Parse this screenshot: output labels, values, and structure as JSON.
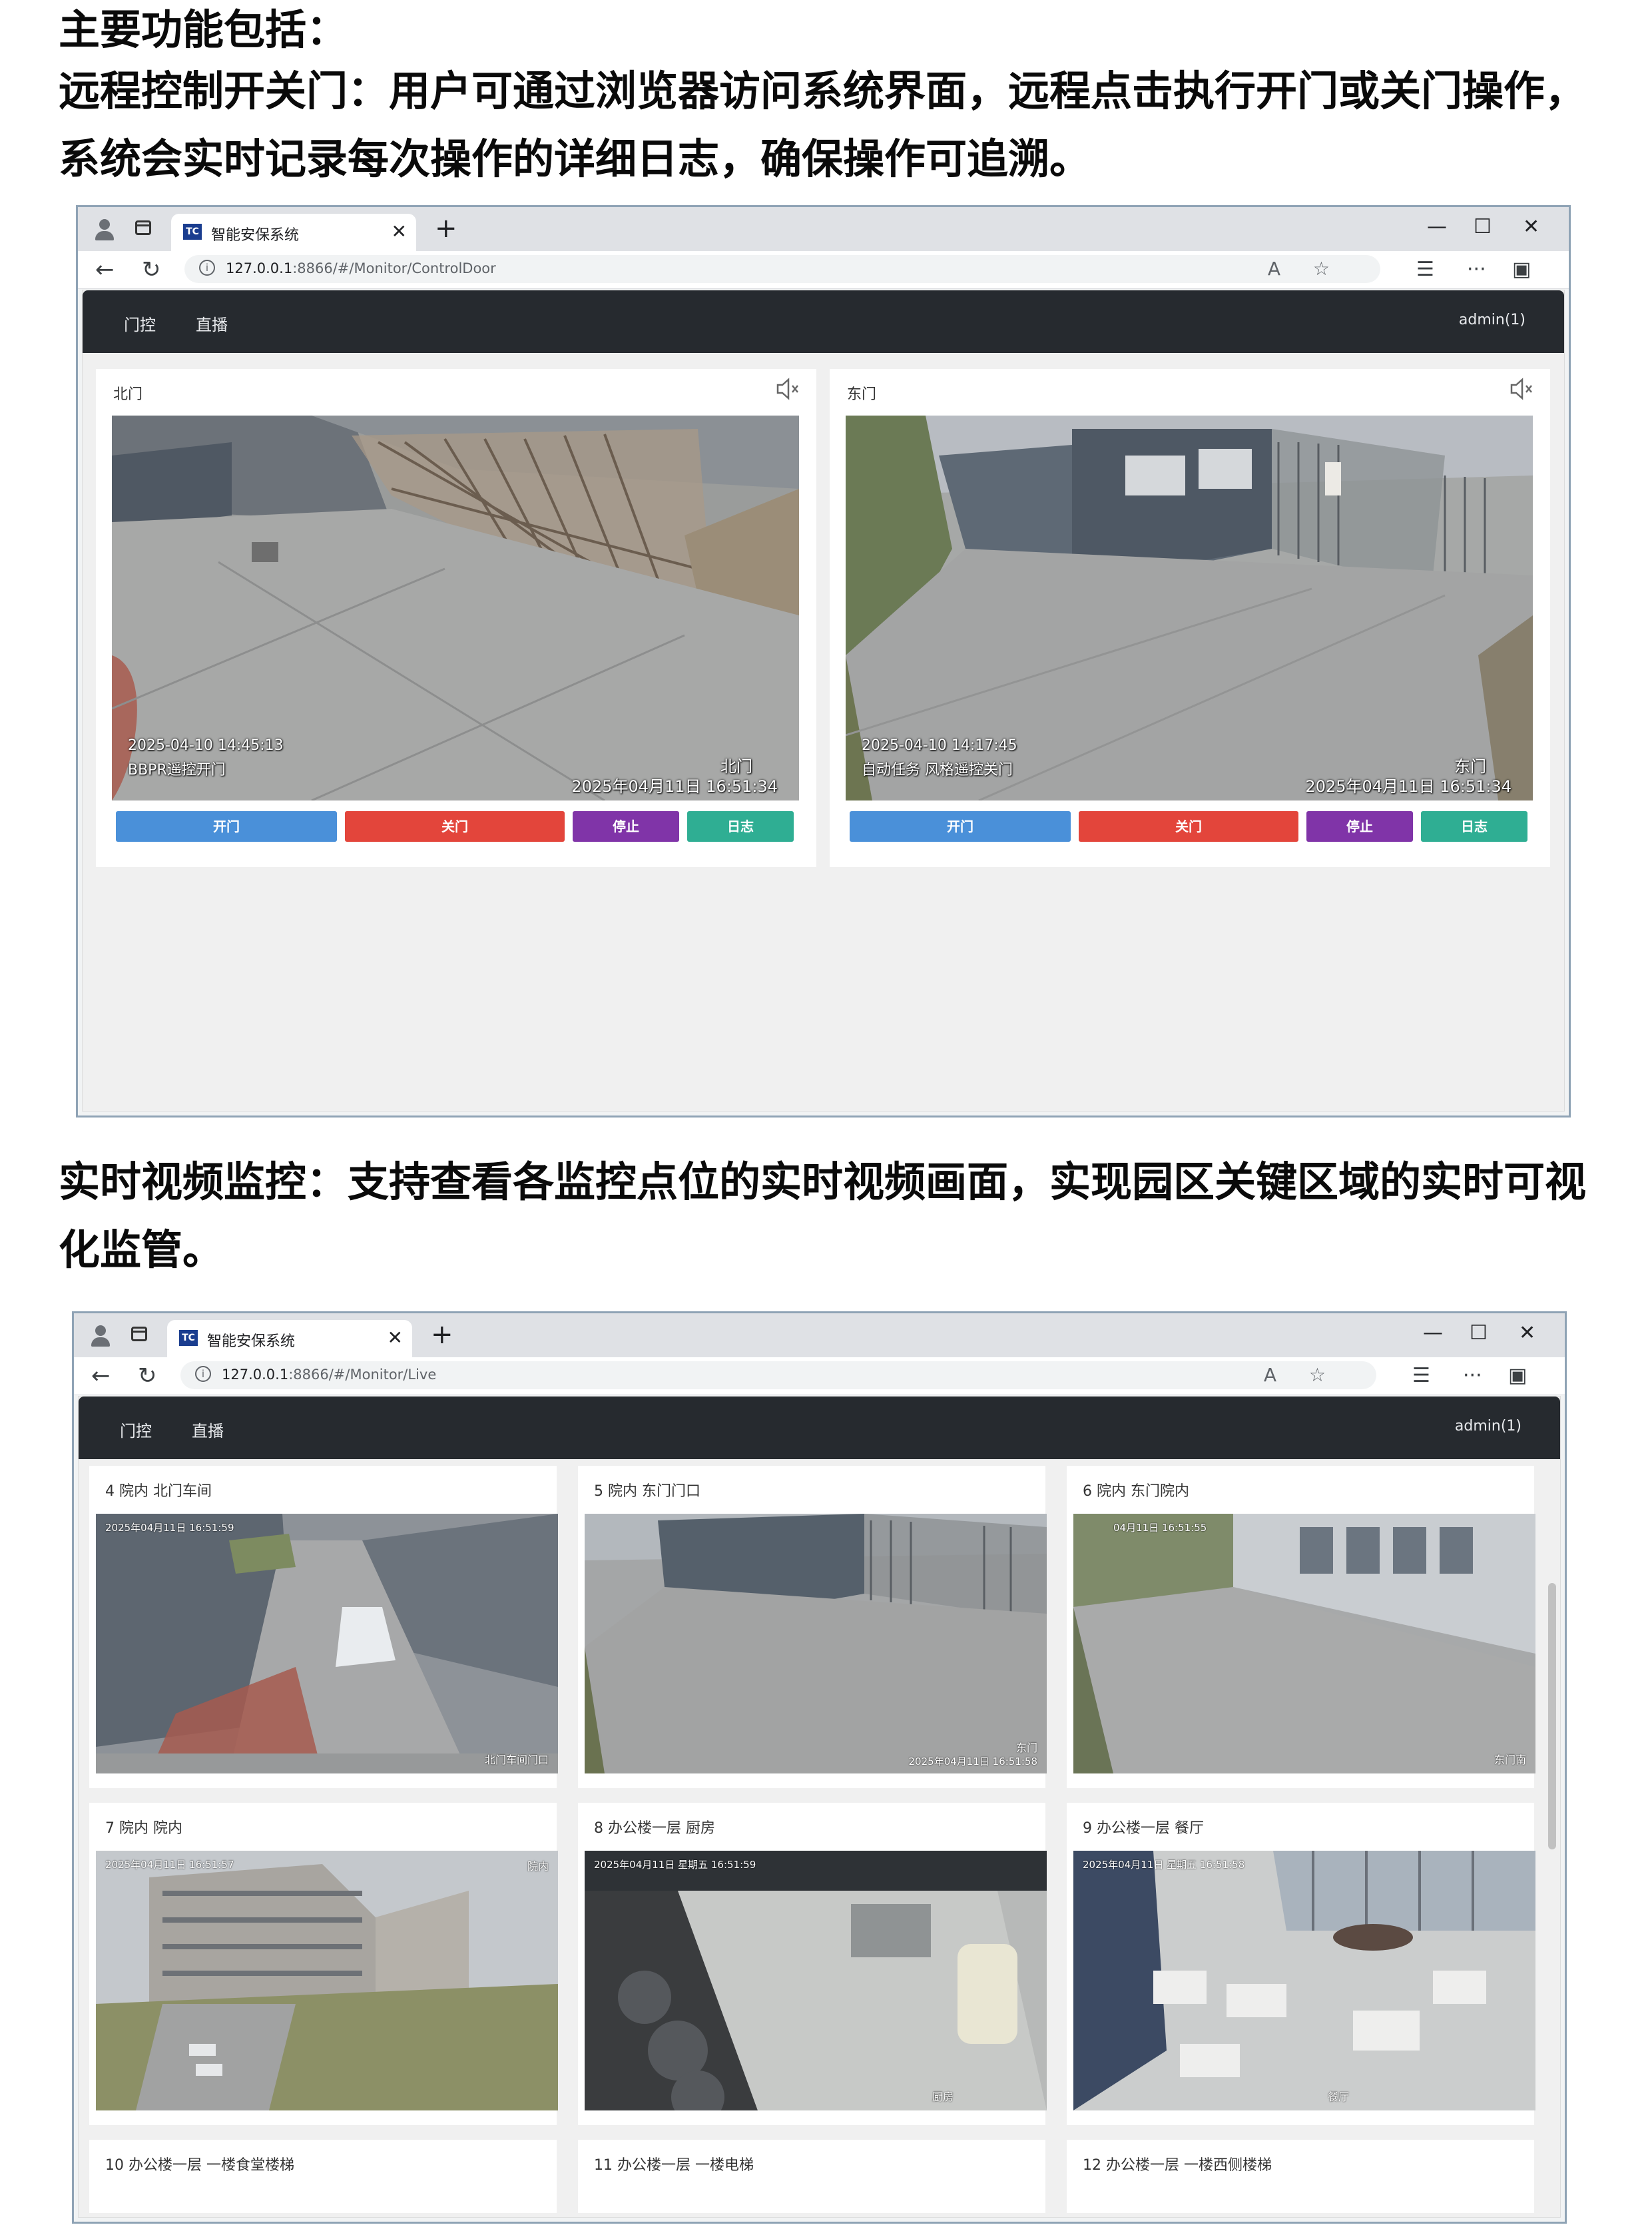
{
  "doc": {
    "intro": "主要功能包括：",
    "section1": "远程控制开关门：用户可通过浏览器访问系统界面，远程点击执行开门或关门操作，系统会实时记录每次操作的详细日志，确保操作可追溯。",
    "section2": "实时视频监控：支持查看各监控点位的实时视频画面，实现园区关键区域的实时可视化监管。"
  },
  "browser": {
    "tab_title": "智能安保系统",
    "favicon": "TC",
    "url_host": "127.0.0.1",
    "url_port": ":8866",
    "url_path_door": "/#/Monitor/ControlDoor",
    "url_path_live": "/#/Monitor/Live"
  },
  "app": {
    "nav": [
      "门控",
      "直播"
    ],
    "user": "admin(1)"
  },
  "door_control": {
    "panels": [
      {
        "title": "北门",
        "osd_line1": "2025-04-10 14:45:13",
        "osd_line2": "BBPR遥控开门",
        "osd_name": "北门",
        "osd_time": "2025年04月11日  16:51:34"
      },
      {
        "title": "东门",
        "osd_line1": "2025-04-10 14:17:45",
        "osd_line2": "自动任务 风格遥控关门",
        "osd_name": "东门",
        "osd_time": "2025年04月11日  16:51:34"
      }
    ],
    "buttons": {
      "open": "开门",
      "close": "关门",
      "stop": "停止",
      "log": "日志"
    },
    "colors": {
      "open": "#4a90d9",
      "close": "#e3453b",
      "stop": "#8034a8",
      "log": "#2fae93"
    }
  },
  "live": {
    "cameras": [
      {
        "title": "4 院内 北门车间",
        "osd": "2025年04月11日  16:51:59",
        "name": "北门车间门口"
      },
      {
        "title": "5 院内 东门门口",
        "osd": "2025年04月11日  16:51:58",
        "name": "东门"
      },
      {
        "title": "6 院内 东门院内",
        "osd": "04月11日  16:51:55",
        "name": "东门南"
      },
      {
        "title": "7 院内 院内",
        "osd": "2025年04月11日  16:51:57",
        "name": "院内"
      },
      {
        "title": "8 办公楼一层 厨房",
        "osd": "2025年04月11日  星期五  16:51:59",
        "name": "厨房"
      },
      {
        "title": "9 办公楼一层 餐厅",
        "osd": "2025年04月11日  星期五  16:51:58",
        "name": "餐厅"
      },
      {
        "title": "10 办公楼一层 一楼食堂楼梯",
        "osd": "",
        "name": ""
      },
      {
        "title": "11 办公楼一层 一楼电梯",
        "osd": "",
        "name": ""
      },
      {
        "title": "12 办公楼一层 一楼西侧楼梯",
        "osd": "",
        "name": ""
      }
    ]
  }
}
